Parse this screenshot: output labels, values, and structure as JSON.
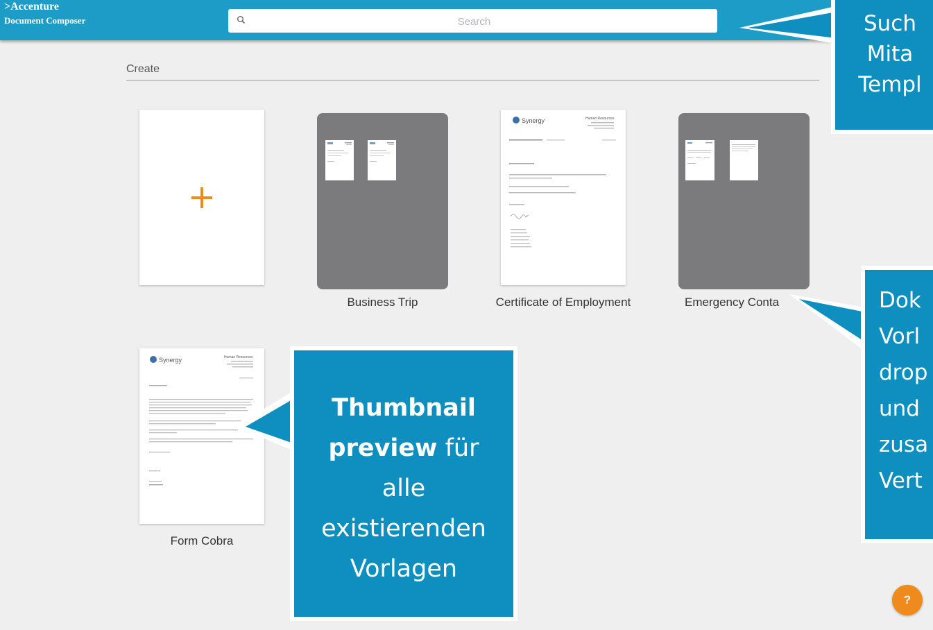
{
  "app": {
    "brand": ">Accenture",
    "product": "Document Composer"
  },
  "search": {
    "placeholder": "Search",
    "icon": "search-icon"
  },
  "section": {
    "title": "Create"
  },
  "templates": [
    {
      "name": "",
      "kind": "new",
      "icon": "plus-icon"
    },
    {
      "name": "Business Trip",
      "kind": "group"
    },
    {
      "name": "Certificate of Employment",
      "kind": "document"
    },
    {
      "name": "Emergency Conta",
      "kind": "group"
    },
    {
      "name": "Form Cobra",
      "kind": "document"
    }
  ],
  "thumbnail": {
    "logo": "Synergy",
    "sender": "Human Resources"
  },
  "callouts": {
    "search": {
      "lines": [
        "Such",
        "Mita",
        "Templ"
      ]
    },
    "dropdown": {
      "lines": [
        "Dok",
        "Vorl",
        "drop",
        "und",
        "zusa",
        "Vert"
      ]
    },
    "thumbnail": {
      "bold1": "Thumbnail",
      "bold2": "preview",
      "rest2": " für",
      "line3": "alle",
      "line4": "existierenden",
      "line5": "Vorlagen"
    }
  },
  "help": {
    "label": "?"
  },
  "colors": {
    "header": "#1d9cc8",
    "callout": "#0f8fbf",
    "accent": "#ef8a1c",
    "group": "#7b7b7e"
  }
}
